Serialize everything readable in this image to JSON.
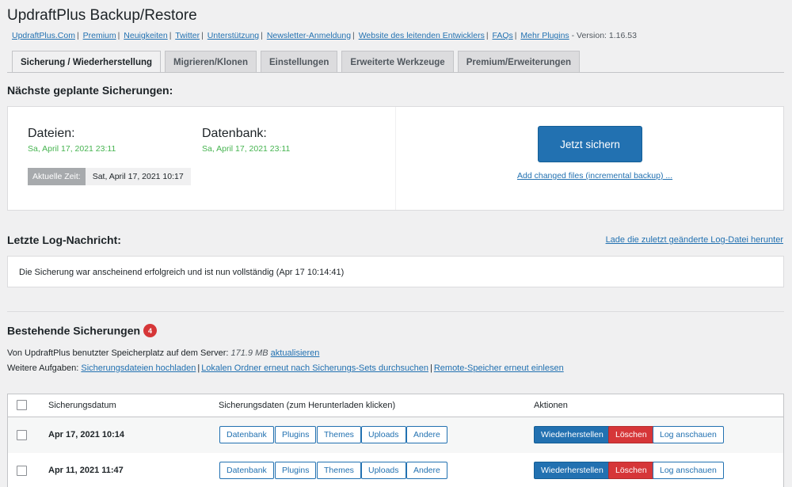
{
  "page": {
    "title": "UpdraftPlus Backup/Restore",
    "links": [
      "UpdraftPlus.Com",
      "Premium",
      "Neuigkeiten",
      "Twitter",
      "Unterstützung",
      "Newsletter-Anmeldung",
      "Website des leitenden Entwicklers",
      "FAQs",
      "Mehr Plugins"
    ],
    "version": "- Version: 1.16.53"
  },
  "tabs": [
    "Sicherung / Wiederherstellung",
    "Migrieren/Klonen",
    "Einstellungen",
    "Erweiterte Werkzeuge",
    "Premium/Erweiterungen"
  ],
  "scheduled": {
    "heading": "Nächste geplante Sicherungen:",
    "files_label": "Dateien:",
    "files_date": "Sa, April 17, 2021 23:11",
    "db_label": "Datenbank:",
    "db_date": "Sa, April 17, 2021 23:11",
    "current_time_label": "Aktuelle Zeit:",
    "current_time_value": "Sat, April 17, 2021 10:17",
    "backup_now": "Jetzt sichern",
    "incremental_link": "Add changed files (incremental backup) ..."
  },
  "log": {
    "heading": "Letzte Log-Nachricht:",
    "download_link": "Lade die zuletzt geänderte Log-Datei herunter",
    "message": "Die Sicherung war anscheinend erfolgreich und ist nun vollständig (Apr 17 10:14:41)"
  },
  "existing": {
    "heading": "Bestehende Sicherungen",
    "count": "4",
    "storage_label": "Von UpdraftPlus benutzter Speicherplatz auf dem Server:",
    "storage_value": "171.9 MB",
    "refresh_link": "aktualisieren",
    "tasks_label": "Weitere Aufgaben:",
    "tasks": [
      "Sicherungsdateien hochladen",
      "Lokalen Ordner erneut nach Sicherungs-Sets durchsuchen",
      "Remote-Speicher erneut einlesen"
    ]
  },
  "table": {
    "col_date": "Sicherungsdatum",
    "col_data": "Sicherungsdaten (zum Herunterladen klicken)",
    "col_actions": "Aktionen",
    "data_buttons": [
      "Datenbank",
      "Plugins",
      "Themes",
      "Uploads",
      "Andere"
    ],
    "restore": "Wiederherstellen",
    "delete": "Löschen",
    "view_log": "Log anschauen",
    "rows": [
      {
        "date": "Apr 17, 2021 10:14"
      },
      {
        "date": "Apr 11, 2021 11:47"
      }
    ]
  },
  "colors": {
    "primary": "#2271b1",
    "danger": "#d63638",
    "success": "#46b450"
  }
}
